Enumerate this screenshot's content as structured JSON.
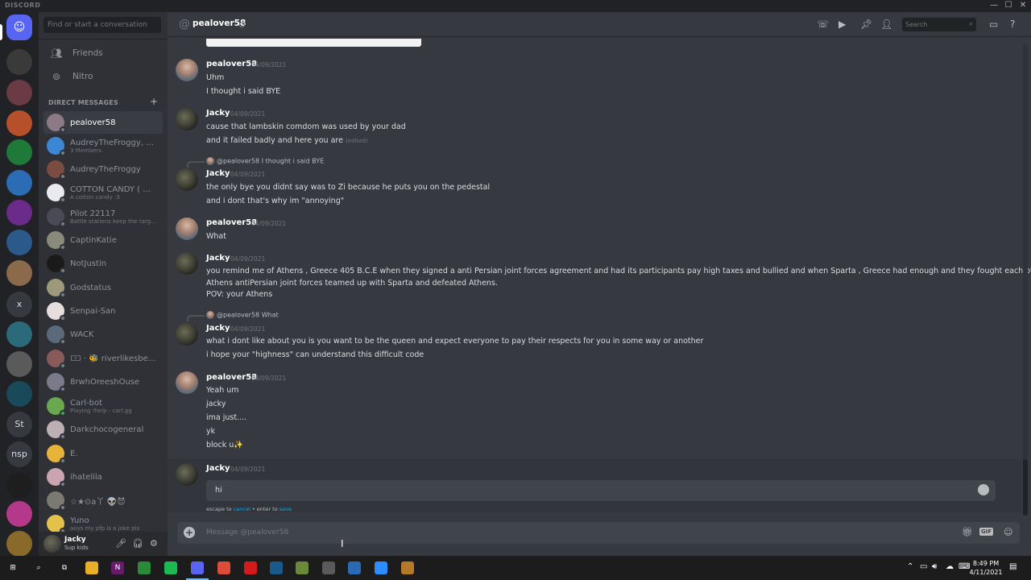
{
  "window": {
    "brand": "DISCORD",
    "controls": [
      "—",
      "☐",
      "✕"
    ]
  },
  "sidebar": {
    "search_placeholder": "Find or start a conversation",
    "nav": [
      {
        "label": "Friends",
        "icon": "friends-icon"
      },
      {
        "label": "Nitro",
        "icon": "nitro-icon"
      }
    ],
    "dm_header": "DIRECT MESSAGES",
    "dms": [
      {
        "name": "pealover58",
        "sub": "",
        "active": true,
        "color": "#8c7a86"
      },
      {
        "name": "AudreyTheFroggy, C...",
        "sub": "3 Members",
        "active": false,
        "color": "#3b87d5"
      },
      {
        "name": "AudreyTheFroggy",
        "sub": "",
        "active": false,
        "color": "#7a4c42"
      },
      {
        "name": "COTTON CANDY ( ...",
        "sub": "A cotton candy :3",
        "active": false,
        "color": "#e9e9ee"
      },
      {
        "name": "Pilot 22117",
        "sub": "Battle stations keep the targe...",
        "active": false,
        "color": "#4a4a55"
      },
      {
        "name": "CaptinKatie",
        "sub": "",
        "active": false,
        "color": "#8a8a7a"
      },
      {
        "name": "NotJustin",
        "sub": "",
        "active": false,
        "color": "#1a1a1a"
      },
      {
        "name": "Godstatus",
        "sub": "",
        "active": false,
        "color": "#9c9a7a"
      },
      {
        "name": "Senpai-San",
        "sub": "",
        "active": false,
        "color": "#e6dede"
      },
      {
        "name": "WACK",
        "sub": "",
        "active": false,
        "color": "#5a6a7a"
      },
      {
        "name": "🀱 · 🐝 riverlikesbees...",
        "sub": "",
        "active": false,
        "color": "#8a5a5a"
      },
      {
        "name": "8rwhOreeshOuse",
        "sub": "",
        "active": false,
        "color": "#7a7a8a"
      },
      {
        "name": "Carl-bot",
        "sub": "Playing !help - carl.gg",
        "active": false,
        "color": "#6aa84f"
      },
      {
        "name": "Darkchocogeneral",
        "sub": "",
        "active": false,
        "color": "#bcb0b5"
      },
      {
        "name": "E.",
        "sub": "",
        "active": false,
        "color": "#e8b339"
      },
      {
        "name": "ihatelila",
        "sub": "",
        "active": false,
        "color": "#caa4b0"
      },
      {
        "name": "☆★⊙a丫 👽😈",
        "sub": "",
        "active": false,
        "color": "#7a7a70"
      },
      {
        "name": "Yuno",
        "sub": "aoys my pfp is a joke pls",
        "active": false,
        "color": "#e4c24a"
      }
    ]
  },
  "guilds": [
    {
      "label": "",
      "icon": "discord-home-icon",
      "color": "#5865f2"
    },
    {
      "label": "",
      "icon": "guild-icon",
      "color": "#3a3a3a"
    },
    {
      "label": "",
      "icon": "guild-icon",
      "color": "#6b3b45"
    },
    {
      "label": "",
      "icon": "guild-icon",
      "color": "#b5502b"
    },
    {
      "label": "",
      "icon": "guild-icon",
      "color": "#1f7a3a"
    },
    {
      "label": "",
      "icon": "guild-icon",
      "color": "#2b6cb5"
    },
    {
      "label": "",
      "icon": "guild-icon",
      "color": "#6a2b8a"
    },
    {
      "label": "",
      "icon": "guild-icon",
      "color": "#2b5a8a"
    },
    {
      "label": "",
      "icon": "guild-icon",
      "color": "#8a6a4a"
    },
    {
      "label": "x",
      "icon": "guild-icon",
      "color": "#36393f"
    },
    {
      "label": "",
      "icon": "guild-icon",
      "color": "#2a6a7a"
    },
    {
      "label": "",
      "icon": "guild-icon",
      "color": "#5a5a5a"
    },
    {
      "label": "",
      "icon": "guild-icon",
      "color": "#1a4a5a"
    },
    {
      "label": "St",
      "icon": "guild-icon",
      "color": "#36393f"
    },
    {
      "label": "nsp",
      "icon": "guild-icon",
      "color": "#36393f"
    },
    {
      "label": "",
      "icon": "guild-icon",
      "color": "#1e1e1e"
    },
    {
      "label": "",
      "icon": "guild-icon",
      "color": "#b5398a"
    },
    {
      "label": "",
      "icon": "guild-icon",
      "color": "#8a6a2a"
    }
  ],
  "user_panel": {
    "name": "Jacky",
    "status": "Sup kids"
  },
  "chat": {
    "title": "pealover58",
    "search_placeholder": "Search",
    "messages": [
      {
        "author": "pealover58",
        "time": "04/09/2021",
        "lines": [
          "Uhm",
          "I thought i said BYE"
        ]
      },
      {
        "author": "Jacky",
        "time": "04/09/2021",
        "lines": [
          "cause that lambskin comdom was used by your dad",
          "and it failed badly and here you are"
        ],
        "edited": "(edited)"
      },
      {
        "reply_to": "@pealover58",
        "reply_text": "I thought i said BYE",
        "author": "Jacky",
        "time": "04/09/2021",
        "lines": [
          "the only bye you didnt say was to Zi because he puts you on the pedestal",
          "and i dont that's why im \"annoying\""
        ]
      },
      {
        "author": "pealover58",
        "time": "04/09/2021",
        "lines": [
          "What"
        ]
      },
      {
        "author": "Jacky",
        "time": "04/09/2021",
        "lines": [
          "you remind me of Athens , Greece 405 B.C.E  when they signed a anti Persian joint forces agreement and had its participants pay high taxes and bullied and when Sparta , Greece had enough and they fought each other",
          "Athens antiPersian joint forces teamed up with Sparta and defeated Athens.",
          "POV: your Athens"
        ]
      },
      {
        "reply_to": "@pealover58",
        "reply_text": "What",
        "author": "Jacky",
        "time": "04/09/2021",
        "lines": [
          "what i dont like about you is you want to be the queen and expect everyone to pay their respects for you in some way or another",
          "i hope your \"highness\" can understand this difficult code"
        ]
      },
      {
        "author": "pealover58",
        "time": "04/09/2021",
        "lines": [
          "Yeah um",
          "jacky",
          "ima just....",
          "yk",
          "block u✨"
        ]
      },
      {
        "author": "Jacky",
        "time": "04/09/2021"
      }
    ],
    "edit": {
      "value": "hi",
      "hint_prefix": "escape to ",
      "cancel": "cancel",
      "hint_mid": " • enter to ",
      "save": "save"
    },
    "composer_placeholder": "Message @pealover58",
    "gif_label": "GIF"
  },
  "taskbar": {
    "apps": [
      {
        "icon": "windows-start-icon",
        "color": "#1c1c1c",
        "label": "⊞"
      },
      {
        "icon": "search-icon",
        "color": "#1c1c1c",
        "label": "⌕"
      },
      {
        "icon": "task-view-icon",
        "color": "#1c1c1c",
        "label": "⧉"
      },
      {
        "icon": "file-explorer-icon",
        "color": "#e8b02a",
        "label": ""
      },
      {
        "icon": "next-app-icon",
        "color": "#6a1a6a",
        "label": "N"
      },
      {
        "icon": "xbox-icon",
        "color": "#2a8a3a",
        "label": ""
      },
      {
        "icon": "spotify-icon",
        "color": "#1db954",
        "label": ""
      },
      {
        "icon": "discord-taskbar-icon",
        "color": "#5865f2",
        "label": ""
      },
      {
        "icon": "chrome-icon",
        "color": "#dd4b39",
        "label": ""
      },
      {
        "icon": "opera-icon",
        "color": "#d41a1a",
        "label": ""
      },
      {
        "icon": "app-icon",
        "color": "#1a5a8a",
        "label": ""
      },
      {
        "icon": "minecraft-icon",
        "color": "#6a8a3a",
        "label": ""
      },
      {
        "icon": "tool-icon",
        "color": "#5a5a5a",
        "label": ""
      },
      {
        "icon": "app-icon",
        "color": "#2a6ab5",
        "label": ""
      },
      {
        "icon": "zoom-icon",
        "color": "#2d8cff",
        "label": ""
      },
      {
        "icon": "package-icon",
        "color": "#b5792a",
        "label": ""
      }
    ],
    "time": "8:49 PM",
    "date": "4/11/2021"
  }
}
